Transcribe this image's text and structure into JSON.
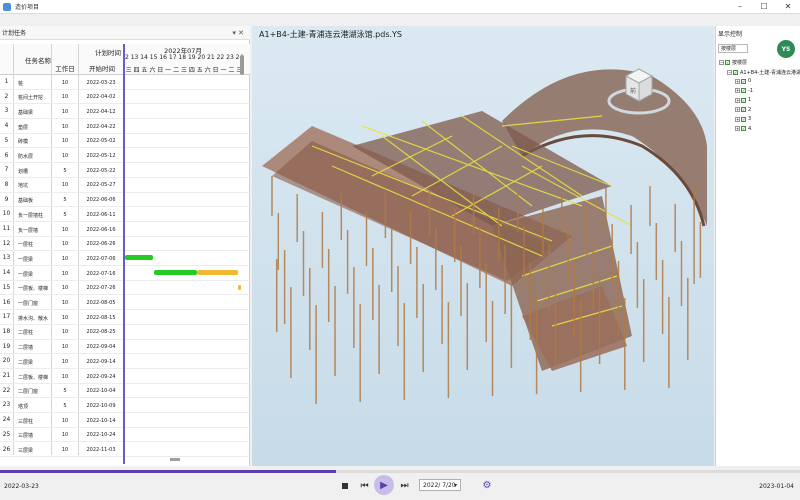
{
  "window": {
    "title": "造价项目"
  },
  "left_panel": {
    "title": "计划任务",
    "headers": {
      "task_name": "任务名称",
      "duration": "工作日",
      "plan_time": "计划时间",
      "start_time": "开始时间",
      "month": "2022年07月"
    },
    "day_ticks": "2 13 14 15 16 17 18 19 20 21 22 23 24 25 2",
    "weekday_ticks": "三 四 五 六 日 一 二 三 四 五 六 日 一 二 三",
    "rows": [
      {
        "n": "1",
        "name": "桩",
        "dur": "10",
        "date": "2022-03-23"
      },
      {
        "n": "2",
        "name": "桩间土开挖",
        "dur": "10",
        "date": "2022-04-02"
      },
      {
        "n": "3",
        "name": "基础梁",
        "dur": "10",
        "date": "2022-04-12"
      },
      {
        "n": "4",
        "name": "垫层",
        "dur": "10",
        "date": "2022-04-22"
      },
      {
        "n": "5",
        "name": "砖模",
        "dur": "10",
        "date": "2022-05-02"
      },
      {
        "n": "6",
        "name": "防水层",
        "dur": "10",
        "date": "2022-05-12"
      },
      {
        "n": "7",
        "name": "划槽",
        "dur": "5",
        "date": "2022-05-22"
      },
      {
        "n": "8",
        "name": "地坑",
        "dur": "10",
        "date": "2022-05-27"
      },
      {
        "n": "9",
        "name": "基础板",
        "dur": "5",
        "date": "2022-06-06"
      },
      {
        "n": "10",
        "name": "负一层墙柱",
        "dur": "5",
        "date": "2022-06-11"
      },
      {
        "n": "11",
        "name": "负一层墙",
        "dur": "10",
        "date": "2022-06-16"
      },
      {
        "n": "12",
        "name": "一层柱",
        "dur": "10",
        "date": "2022-06-26"
      },
      {
        "n": "13",
        "name": "一层梁",
        "dur": "10",
        "date": "2022-07-06"
      },
      {
        "n": "14",
        "name": "一层梁",
        "dur": "10",
        "date": "2022-07-16"
      },
      {
        "n": "15",
        "name": "一层板、楼梯",
        "dur": "10",
        "date": "2022-07-26"
      },
      {
        "n": "16",
        "name": "一层门窗",
        "dur": "10",
        "date": "2022-08-05"
      },
      {
        "n": "17",
        "name": "排水沟、散水",
        "dur": "10",
        "date": "2022-08-15"
      },
      {
        "n": "18",
        "name": "二层柱",
        "dur": "10",
        "date": "2022-08-25"
      },
      {
        "n": "19",
        "name": "二层墙",
        "dur": "10",
        "date": "2022-09-04"
      },
      {
        "n": "20",
        "name": "二层梁",
        "dur": "10",
        "date": "2022-09-14"
      },
      {
        "n": "21",
        "name": "二层板、楼梯",
        "dur": "10",
        "date": "2022-09-24"
      },
      {
        "n": "22",
        "name": "二层门窗",
        "dur": "5",
        "date": "2022-10-04"
      },
      {
        "n": "23",
        "name": "塔顶",
        "dur": "5",
        "date": "2022-10-09"
      },
      {
        "n": "24",
        "name": "三层柱",
        "dur": "10",
        "date": "2022-10-14"
      },
      {
        "n": "25",
        "name": "三层墙",
        "dur": "10",
        "date": "2022-10-24"
      },
      {
        "n": "26",
        "name": "三层梁",
        "dur": "10",
        "date": "2022-11-03"
      }
    ]
  },
  "view": {
    "title": "A1+B4-土建-青浦连云港湖泳馆.pds.YS",
    "cube_face": "前"
  },
  "right_panel": {
    "title": "显示控制",
    "select_value": "按楼层",
    "tree": [
      {
        "label": "按楼层",
        "level": 0
      },
      {
        "label": "A1+B4-土建-青浦连云港湖泳馆",
        "level": 1
      },
      {
        "label": "0",
        "level": 2
      },
      {
        "label": "-1",
        "level": 2
      },
      {
        "label": "1",
        "level": 2
      },
      {
        "label": "2",
        "level": 2
      },
      {
        "label": "3",
        "level": 2
      },
      {
        "label": "4",
        "level": 2
      }
    ],
    "logo_text": "YS"
  },
  "timeline": {
    "start": "2022-03-23",
    "end": "2023-01-04",
    "current": "2022/ 7/20",
    "progress": 0.42
  },
  "colors": {
    "accent": "#5a3fb0",
    "gantt_done": "#22cc22",
    "gantt_todo": "#f0b830"
  }
}
